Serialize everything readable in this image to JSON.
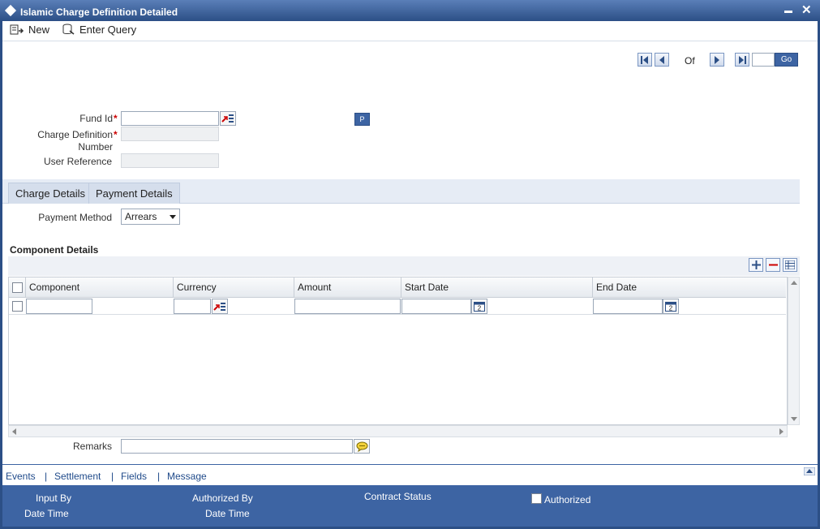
{
  "window": {
    "title": "Islamic Charge Definition Detailed"
  },
  "toolbar": {
    "new_label": "New",
    "enter_query_label": "Enter Query"
  },
  "pager": {
    "of_label": "Of",
    "go_label": "Go",
    "page_value": ""
  },
  "form": {
    "fund_id_label": "Fund Id",
    "fund_id_value": "",
    "charge_def_label_line1": "Charge Definition",
    "charge_def_label_line2": "Number",
    "charge_def_value": "",
    "user_ref_label": "User Reference",
    "user_ref_value": "",
    "p_button_label": "P",
    "required_mark": "*"
  },
  "tabs": [
    {
      "label": "Charge Details"
    },
    {
      "label": "Payment Details"
    }
  ],
  "payment": {
    "method_label": "Payment Method",
    "method_value": "Arrears"
  },
  "component_section": {
    "title": "Component Details",
    "columns": [
      "Component",
      "Currency",
      "Amount",
      "Start Date",
      "End Date"
    ],
    "rows": [
      {
        "component": "",
        "currency": "",
        "amount": "",
        "start_date": "",
        "end_date": ""
      }
    ]
  },
  "remarks": {
    "label": "Remarks",
    "value": ""
  },
  "footer_links": [
    "Events",
    "Settlement",
    "Fields",
    "Message"
  ],
  "footer_separator": "|",
  "status": {
    "input_by": "Input By",
    "date_time_1": "Date Time",
    "authorized_by": "Authorized By",
    "date_time_2": "Date Time",
    "contract_status": "Contract Status",
    "authorized": "Authorized"
  },
  "colors": {
    "title_bar": "#2c4f86",
    "footer": "#3d64a3",
    "required": "#cc0000"
  }
}
